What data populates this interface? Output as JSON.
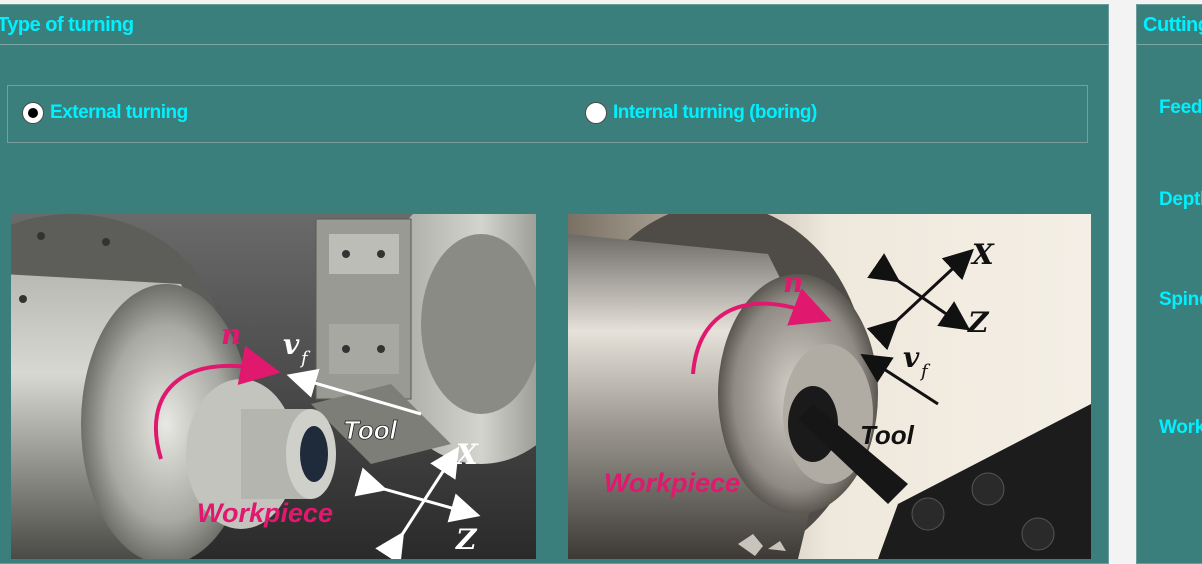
{
  "turning_panel": {
    "title": "Type of turning",
    "options": [
      {
        "label": "External turning",
        "selected": true
      },
      {
        "label": "Internal turning (boring)",
        "selected": false
      }
    ],
    "images": [
      {
        "name": "external-turning-photo",
        "labels": {
          "n": "n",
          "vf_main": "v",
          "vf_sub": "f",
          "tool": "Tool",
          "workpiece": "Workpiece",
          "x": "X",
          "z": "Z"
        }
      },
      {
        "name": "internal-turning-photo",
        "labels": {
          "n": "n",
          "vf_main": "v",
          "vf_sub": "f",
          "tool": "Tool",
          "workpiece": "Workpiece",
          "x": "X",
          "z": "Z"
        }
      }
    ]
  },
  "cutting_panel": {
    "title": "Cutting",
    "labels": [
      "Feed",
      "Depth",
      "Spindle",
      "Work"
    ]
  },
  "colors": {
    "panel_bg": "#3b7f7c",
    "accent_text": "#00f0ff",
    "label_magenta": "#e0186e"
  }
}
